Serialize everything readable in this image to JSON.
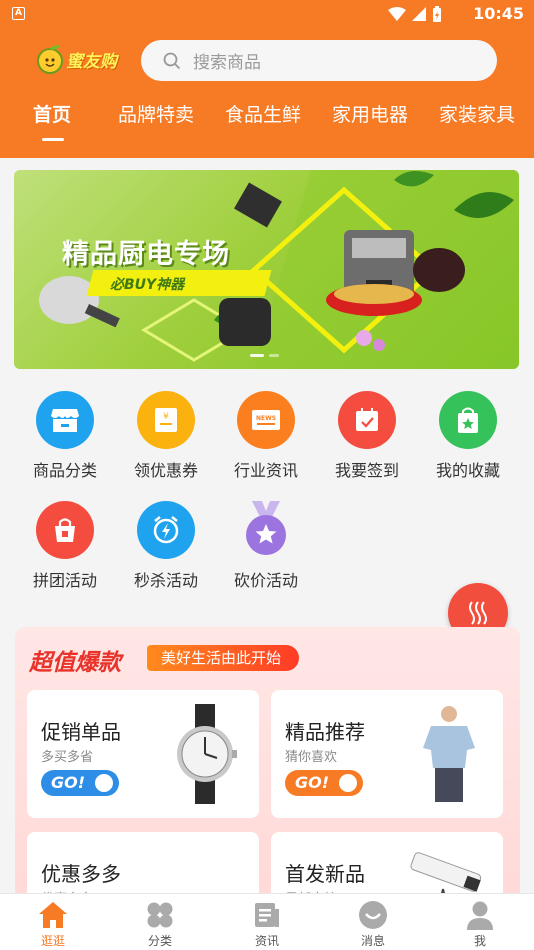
{
  "status_bar": {
    "time": "10:45",
    "left_icon": "A"
  },
  "header": {
    "logo_text": "蜜友购",
    "search_placeholder": "搜索商品",
    "tabs": [
      {
        "label": "首页",
        "active": true
      },
      {
        "label": "品牌特卖"
      },
      {
        "label": "食品生鲜"
      },
      {
        "label": "家用电器"
      },
      {
        "label": "家装家具"
      }
    ]
  },
  "banner": {
    "headline": "精品厨电专场",
    "slogan": "必BUY神器",
    "slide_count": 2,
    "active_slide": 0
  },
  "quick_menu": [
    {
      "label": "商品分类",
      "icon": "store-icon",
      "color": "#1fa3ee"
    },
    {
      "label": "领优惠券",
      "icon": "coupon-icon",
      "color": "#fbb10e"
    },
    {
      "label": "行业资讯",
      "icon": "news-icon",
      "color": "#fb7f1f"
    },
    {
      "label": "我要签到",
      "icon": "calendar-check-icon",
      "color": "#f54c40"
    },
    {
      "label": "我的收藏",
      "icon": "favorite-bag-icon",
      "color": "#35c25a"
    },
    {
      "label": "拼团活动",
      "icon": "shopping-basket-icon",
      "color": "#f54c40"
    },
    {
      "label": "秒杀活动",
      "icon": "alarm-bolt-icon",
      "color": "#1fa3ee"
    },
    {
      "label": "砍价活动",
      "icon": "medal-star-icon",
      "color": "#9b74e0"
    }
  ],
  "promo": {
    "title": "超值爆款",
    "tagline": "美好生活由此开始",
    "cards": [
      {
        "title": "促销单品",
        "subtitle": "多买多省",
        "go": "GO!",
        "go_color": "#2e8de6",
        "image": "watch-icon"
      },
      {
        "title": "精品推荐",
        "subtitle": "猜你喜欢",
        "go": "GO!",
        "go_color": "#f77a24",
        "image": "shirt-model-icon"
      },
      {
        "title": "优惠多多",
        "subtitle": "优惠多多",
        "image": ""
      },
      {
        "title": "首发新品",
        "subtitle": "最新出炉",
        "image": "telescope-icon"
      }
    ]
  },
  "bottom_nav": [
    {
      "label": "逛逛",
      "icon": "home-icon",
      "active": true
    },
    {
      "label": "分类",
      "icon": "category-icon"
    },
    {
      "label": "资讯",
      "icon": "document-icon"
    },
    {
      "label": "消息",
      "icon": "message-smile-icon"
    },
    {
      "label": "我",
      "icon": "user-icon"
    }
  ],
  "colors": {
    "brand": "#f77a24",
    "accent_red": "#e8332a"
  }
}
